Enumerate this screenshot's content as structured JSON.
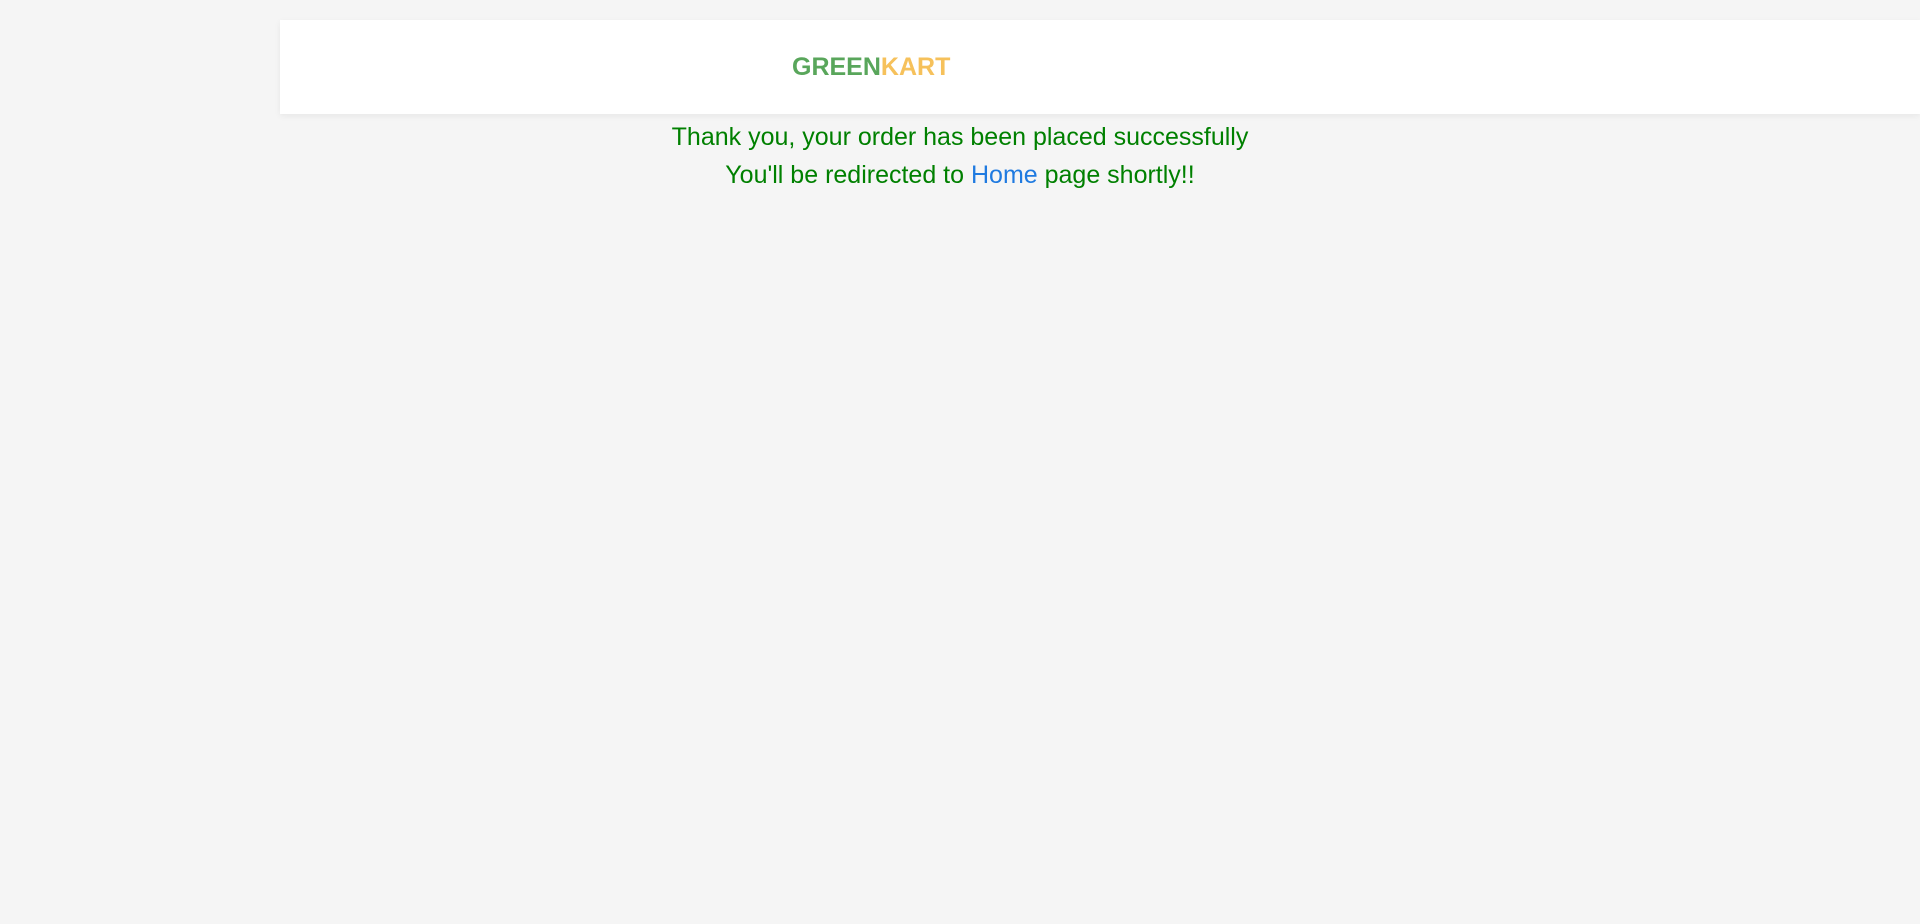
{
  "brand": {
    "part1": "GREEN",
    "part2": "KART"
  },
  "message": {
    "line1": "Thank you, your order has been placed successfully",
    "line2_prefix": "You'll be redirected to ",
    "home_link": "Home",
    "line2_suffix": " page shortly!!"
  },
  "colors": {
    "brand_green": "#59a65b",
    "brand_orange": "#f6c15b",
    "message_text": "#008000",
    "link": "#1f7ae0",
    "background": "#f5f5f5"
  }
}
